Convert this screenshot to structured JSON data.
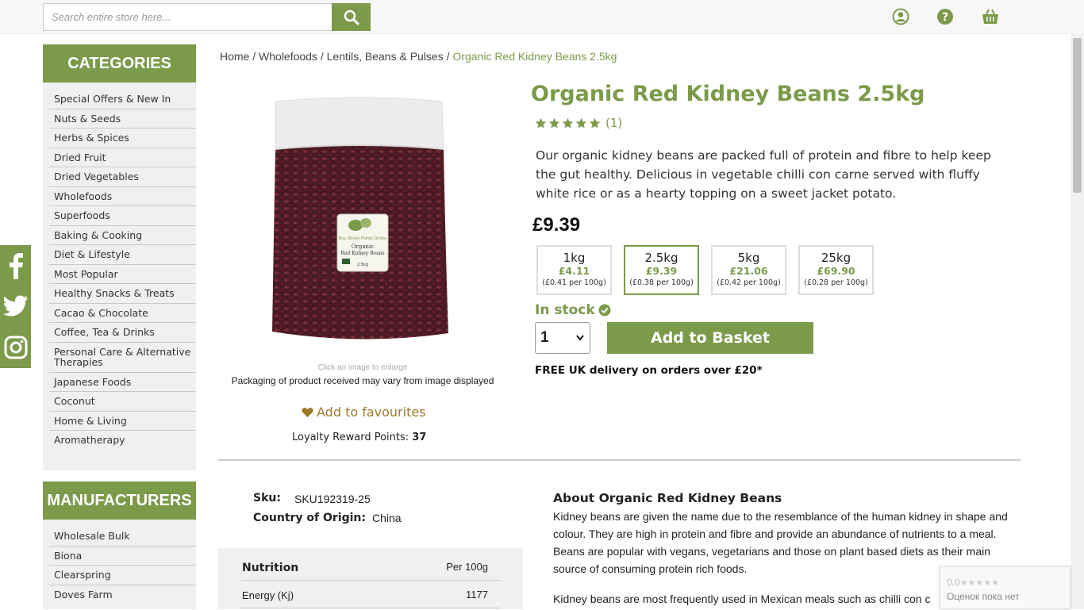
{
  "header": {
    "search_placeholder": "Search entire store here...",
    "icons": [
      "account-icon",
      "help-icon",
      "basket-icon"
    ]
  },
  "social": [
    "facebook-icon",
    "twitter-icon",
    "instagram-icon"
  ],
  "categories": {
    "title": "CATEGORIES",
    "items": [
      "Special Offers & New In",
      "Nuts & Seeds",
      "Herbs & Spices",
      "Dried Fruit",
      "Dried Vegetables",
      "Wholefoods",
      "Superfoods",
      "Baking & Cooking",
      "Diet & Lifestyle",
      "Most Popular",
      "Healthy Snacks & Treats",
      "Cacao & Chocolate",
      "Coffee, Tea & Drinks",
      "Personal Care & Alternative Therapies",
      "Japanese Foods",
      "Coconut",
      "Home & Living",
      "Aromatherapy"
    ]
  },
  "manufacturers": {
    "title": "MANUFACTURERS",
    "items": [
      "Wholesale Bulk",
      "Biona",
      "Clearspring",
      "Doves Farm"
    ]
  },
  "breadcrumb": {
    "home": "Home",
    "sep": " / ",
    "level1": "Wholefoods",
    "level2": "Lentils, Beans & Pulses",
    "current": "Organic Red Kidney Beans 2.5kg"
  },
  "gallery": {
    "enlarge_hint": "Click an image to enlarge",
    "packaging_note": "Packaging of product received may vary from image displayed",
    "favourites_label": "Add to favourites",
    "loyalty_label": "Loyalty Reward Points:",
    "loyalty_points": "37",
    "pack_label": {
      "brand": "Buy Whole Foods Online",
      "line1": "Organic",
      "line2": "Red Kidney Beans",
      "weight": "2.5kg"
    }
  },
  "product": {
    "title": "Organic Red Kidney Beans 2.5kg",
    "rating": 5,
    "review_count": "(1)",
    "description": "Our organic kidney beans are packed full of protein and fibre to help keep the gut healthy. Delicious in vegetable chilli con carne served with fluffy white rice or as a hearty topping on a sweet jacket potato.",
    "price": "£9.39",
    "variants": [
      {
        "size": "1kg",
        "price": "£4.11",
        "per": "(£0.41 per 100g)",
        "selected": false
      },
      {
        "size": "2.5kg",
        "price": "£9.39",
        "per": "(£0.38 per 100g)",
        "selected": true
      },
      {
        "size": "5kg",
        "price": "£21.06",
        "per": "(£0.42 per 100g)",
        "selected": false
      },
      {
        "size": "25kg",
        "price": "£69.90",
        "per": "(£0.28 per 100g)",
        "selected": false
      }
    ],
    "stock_status": "In stock",
    "quantity": "1",
    "add_to_basket_label": "Add to Basket",
    "delivery_note": "FREE UK delivery on orders over £20*"
  },
  "specs": {
    "sku_label": "Sku:",
    "sku_value": "SKU192319-25",
    "origin_label": "Country of Origin:",
    "origin_value": "China"
  },
  "nutrition": {
    "title": "Nutrition",
    "per_label": "Per 100g",
    "rows": [
      {
        "name": "Energy (Kj)",
        "value": "1177"
      }
    ]
  },
  "about": {
    "title": "About Organic Red Kidney Beans",
    "paragraph1": "Kidney beans are given the name due to the resemblance of the human kidney in shape and colour. They are high in protein and fibre and provide an abundance of nutrients to a meal. Beans are popular with vegans, vegetarians and those on plant based diets as their main source of consuming protein rich foods.",
    "paragraph2": "Kidney beans are most frequently used in Mexican meals such as chilli con c"
  },
  "recaptcha": {
    "score": "0.0",
    "text": "Оценок пока нет"
  },
  "colors": {
    "accent": "#7b9a4a",
    "favourite": "#a07a2a"
  }
}
